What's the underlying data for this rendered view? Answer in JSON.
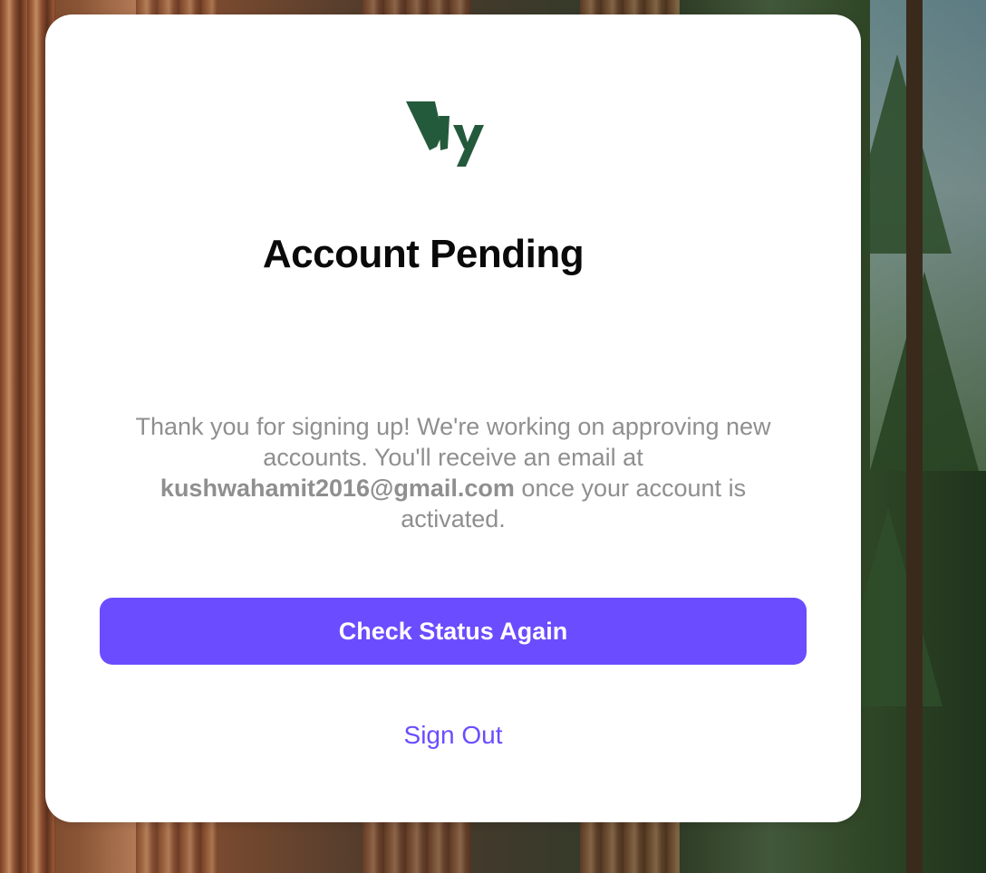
{
  "logo": {
    "icon": "brand-logo-icon",
    "color": "#245a3c"
  },
  "page": {
    "title": "Account Pending"
  },
  "message": {
    "part1": "Thank you for signing up! We're working on approving new accounts. You'll receive an email at",
    "email": "kushwahamit2016@gmail.com",
    "part2": "once your account is activated."
  },
  "actions": {
    "check_status_label": "Check Status Again",
    "sign_out_label": "Sign Out"
  },
  "colors": {
    "accent": "#6b4cff",
    "card_background": "#ffffff",
    "title_text": "#0a0a0a",
    "message_text": "#8f8f8f"
  }
}
